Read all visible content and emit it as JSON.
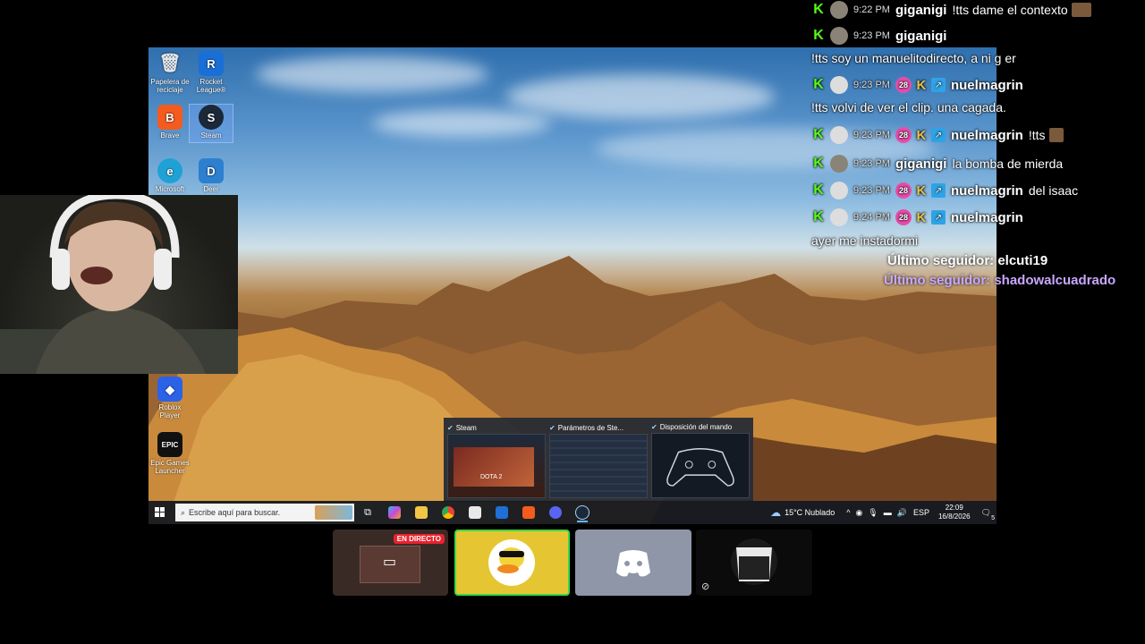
{
  "desktop": {
    "icons": [
      {
        "name": "recycle-bin",
        "label": "Papelera de reciclaje"
      },
      {
        "name": "rocket-league",
        "label": "Rocket League®"
      },
      {
        "name": "brave",
        "label": "Brave"
      },
      {
        "name": "steam",
        "label": "Steam"
      },
      {
        "name": "edge",
        "label": "Microsoft"
      },
      {
        "name": "deer",
        "label": "Deer"
      },
      {
        "name": "roblox",
        "label": "Roblox Player"
      },
      {
        "name": "epic",
        "label": "Epic Games Launcher"
      }
    ],
    "taskbar": {
      "search_placeholder": "Escribe aquí para buscar.",
      "weather": "15°C  Nublado",
      "lang": "ESP",
      "time": "22:09",
      "date": "16/8/2026",
      "notif_count": "5"
    },
    "previews": [
      {
        "title": "Steam",
        "thumb_text": "DOTA 2"
      },
      {
        "title": "Parámetros de Ste..."
      },
      {
        "title": "Disposición del mando"
      }
    ]
  },
  "chat": {
    "messages": [
      {
        "time": "9:22 PM",
        "user": "giganigi",
        "text": "!tts dame el contexto"
      },
      {
        "time": "9:23 PM",
        "user": "giganigi",
        "text": ""
      },
      {
        "text_only": "!tts soy un manuelitodirecto, a ni g er"
      },
      {
        "time": "9:23 PM",
        "user": "nuelmagrin",
        "badge": "28",
        "text": ""
      },
      {
        "text_only": "!tts volvi de ver el clip. una cagada."
      },
      {
        "time": "9:23 PM",
        "user": "nuelmagrin",
        "badge": "28",
        "text": "!tts"
      },
      {
        "time": "9:23 PM",
        "user": "giganigi",
        "text": "la bomba de mierda"
      },
      {
        "time": "9:23 PM",
        "user": "nuelmagrin",
        "badge": "28",
        "text": "del isaac"
      },
      {
        "time": "9:24 PM",
        "user": "nuelmagrin",
        "badge": "28",
        "text": ""
      },
      {
        "text_only": "ayer me instadormi"
      }
    ],
    "followers": [
      {
        "text": "Último seguidor: elcuti19",
        "color": "#ffffff"
      },
      {
        "text": "Último seguidor: shadowalcuadrado",
        "color": "#c8a8ff"
      }
    ]
  },
  "call": {
    "live_label": "EN DIRECTO"
  }
}
